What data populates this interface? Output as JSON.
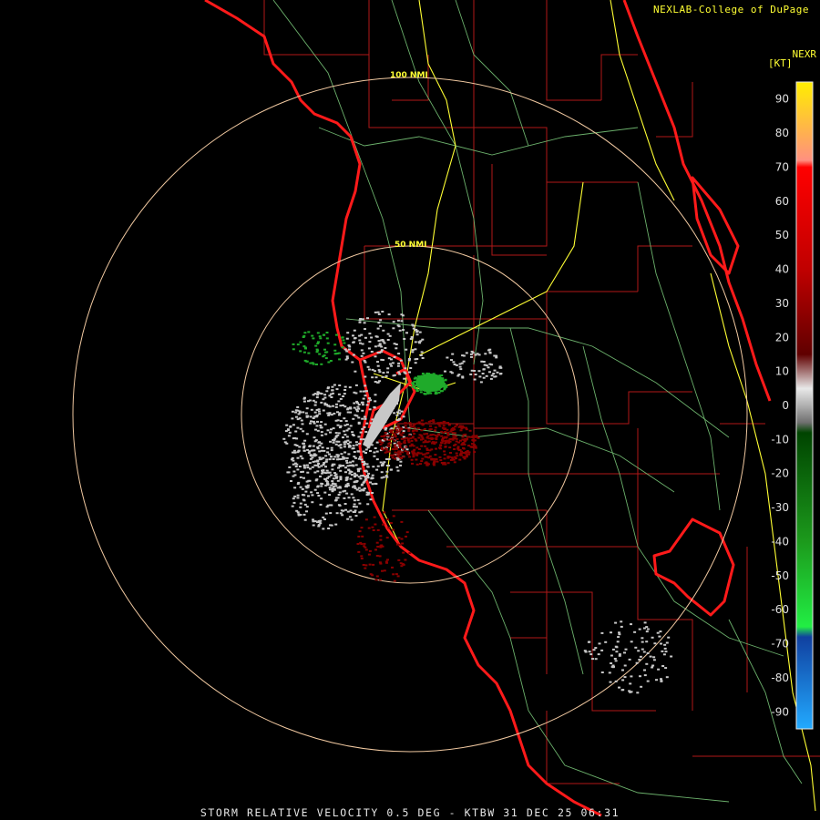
{
  "header": {
    "credit": "NEXLAB-College of DuPage",
    "product_code": "NEXR",
    "units": "[KT]"
  },
  "footer": {
    "caption": "STORM RELATIVE VELOCITY 0.5 DEG - KTBW 31 DEC 25 06:31"
  },
  "range_rings": [
    {
      "label": "50 NMI"
    },
    {
      "label": "100 NMI"
    }
  ],
  "colors": {
    "coastline": "#ff1a1a",
    "county_lines": "#b01818",
    "highways": "#ffff33",
    "roads": "#7fd07f",
    "rings": "#f0c8a0",
    "inbound": "#1faa2a",
    "outbound": "#8b0000",
    "near_zero": "#c8c8c8"
  },
  "color_scale": {
    "ticks": [
      "90",
      "80",
      "70",
      "60",
      "50",
      "40",
      "30",
      "20",
      "10",
      "0",
      "-10",
      "-20",
      "-30",
      "-40",
      "-50",
      "-60",
      "-70",
      "-80",
      "-90"
    ],
    "stops": [
      {
        "value": 95,
        "color": "#ffee00"
      },
      {
        "value": 80,
        "color": "#ffb050"
      },
      {
        "value": 72,
        "color": "#ff9080"
      },
      {
        "value": 70,
        "color": "#ff0000"
      },
      {
        "value": 40,
        "color": "#c00000"
      },
      {
        "value": 15,
        "color": "#600000"
      },
      {
        "value": 5,
        "color": "#e8e8e8"
      },
      {
        "value": 0,
        "color": "#b0b0b0"
      },
      {
        "value": -5,
        "color": "#707070"
      },
      {
        "value": -8,
        "color": "#004400"
      },
      {
        "value": -40,
        "color": "#1c9a1c"
      },
      {
        "value": -65,
        "color": "#22ee44"
      },
      {
        "value": -68,
        "color": "#1040a0"
      },
      {
        "value": -95,
        "color": "#22aaff"
      }
    ]
  }
}
